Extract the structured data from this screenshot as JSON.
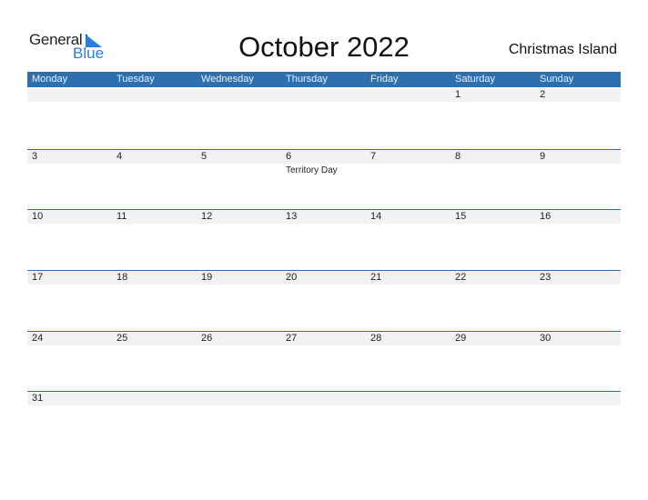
{
  "brand": {
    "word1": "General",
    "word2": "Blue",
    "accent": "#2a7fd4"
  },
  "header": {
    "title": "October 2022",
    "country": "Christmas Island"
  },
  "weekdays": [
    "Monday",
    "Tuesday",
    "Wednesday",
    "Thursday",
    "Friday",
    "Saturday",
    "Sunday"
  ],
  "weeks": [
    {
      "days": [
        "",
        "",
        "",
        "",
        "",
        "1",
        "2"
      ],
      "events": [
        "",
        "",
        "",
        "",
        "",
        "",
        ""
      ]
    },
    {
      "days": [
        "3",
        "4",
        "5",
        "6",
        "7",
        "8",
        "9"
      ],
      "events": [
        "",
        "",
        "",
        "Territory Day",
        "",
        "",
        ""
      ]
    },
    {
      "days": [
        "10",
        "11",
        "12",
        "13",
        "14",
        "15",
        "16"
      ],
      "events": [
        "",
        "",
        "",
        "",
        "",
        "",
        ""
      ]
    },
    {
      "days": [
        "17",
        "18",
        "19",
        "20",
        "21",
        "22",
        "23"
      ],
      "events": [
        "",
        "",
        "",
        "",
        "",
        "",
        ""
      ]
    },
    {
      "days": [
        "24",
        "25",
        "26",
        "27",
        "28",
        "29",
        "30"
      ],
      "events": [
        "",
        "",
        "",
        "",
        "",
        "",
        ""
      ]
    },
    {
      "days": [
        "31",
        "",
        "",
        "",
        "",
        "",
        ""
      ],
      "events": [
        "",
        "",
        "",
        "",
        "",
        "",
        ""
      ]
    }
  ],
  "colors": {
    "header_bg": "#2e6fb0",
    "band_bg": "#f2f2f2"
  }
}
